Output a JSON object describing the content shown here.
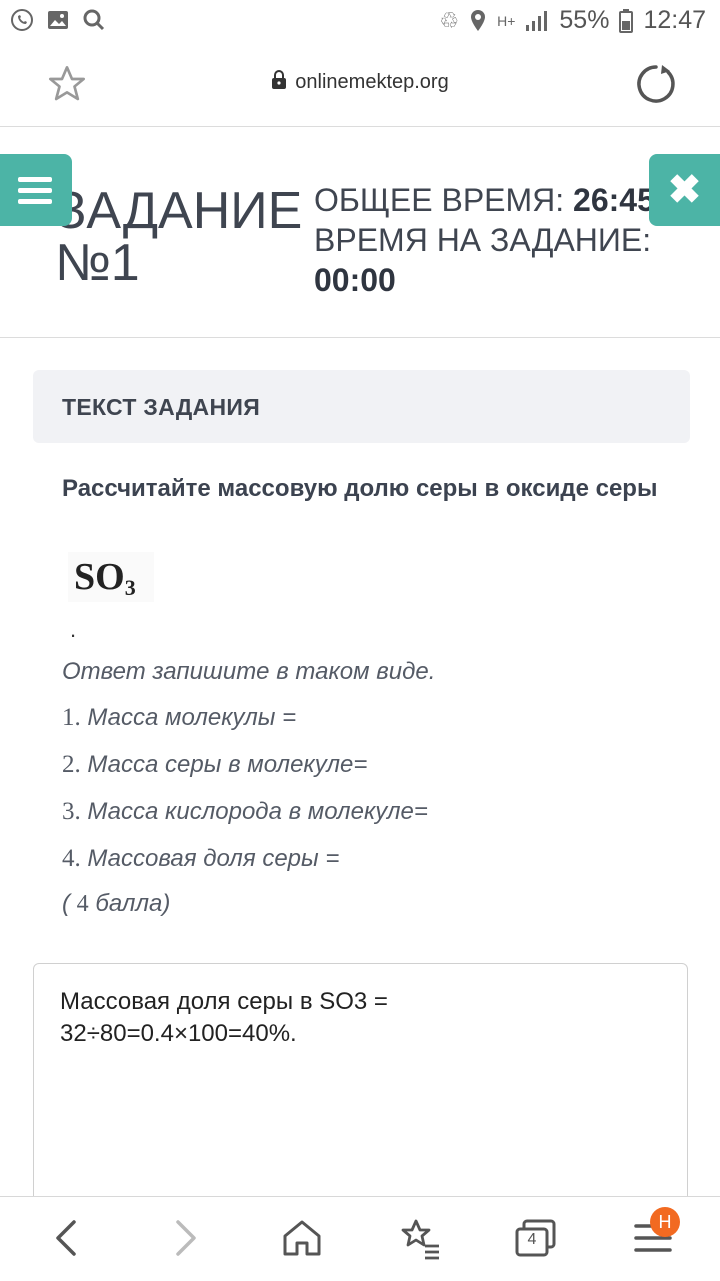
{
  "statusbar": {
    "left_icons": [
      "whatsapp-icon",
      "image-icon",
      "search-icon"
    ],
    "battery": "55%",
    "time": "12:47",
    "network": "H+"
  },
  "browser": {
    "url": "onlinemektep.org"
  },
  "header": {
    "task_label": "ЗАДАНИЕ",
    "task_number": "№1",
    "total_time_label": "ОБЩЕЕ ВРЕМЯ:",
    "total_time_value": "26:45",
    "task_time_label": "ВРЕМЯ НА ЗАДАНИЕ:",
    "task_time_value": "00:00"
  },
  "task": {
    "section_title": "ТЕКСТ ЗАДАНИЯ",
    "question": "Рассчитайте массовую долю серы в оксиде серы",
    "formula_base": "SO",
    "formula_sub": "3",
    "dot": ".",
    "instruction": "Ответ запишите в таком виде.",
    "items": [
      {
        "num": "1.",
        "text": "Масса молекулы ="
      },
      {
        "num": "2.",
        "text": "Масса серы в молекуле="
      },
      {
        "num": "3.",
        "text": "Масса кислорода в молекуле="
      },
      {
        "num": "4.",
        "text": "Массовая доля серы ="
      }
    ],
    "points_open": "( ",
    "points_num": "4",
    "points_text": " балла)"
  },
  "answer": {
    "text": "Массовая доля серы в SO3 =\n32÷80=0.4×100=40%."
  },
  "bottomnav": {
    "tabs_count": "4",
    "badge": "H"
  },
  "colors": {
    "accent": "#4cb4a6",
    "badge": "#f26a21"
  }
}
